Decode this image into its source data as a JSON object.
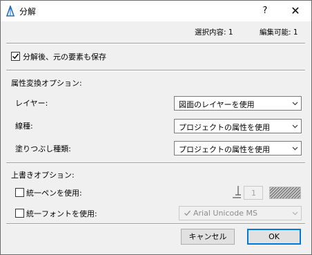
{
  "window": {
    "title": "分解",
    "help": "?",
    "close": "✕"
  },
  "status": {
    "selected": "選択内容: 1",
    "editable": "編集可能: 1"
  },
  "options": {
    "keep_original_label": "分解後、元の要素も保存",
    "keep_original_checked": true
  },
  "attributes": {
    "section_label": "属性変換オプション:",
    "layer_label": "レイヤー:",
    "layer_value": "図面のレイヤーを使用",
    "linetype_label": "線種:",
    "linetype_value": "プロジェクトの属性を使用",
    "fill_label": "塗りつぶし種類:",
    "fill_value": "プロジェクトの属性を使用"
  },
  "override": {
    "section_label": "上書きオプション:",
    "pen_label": "統一ペンを使用:",
    "pen_number": "1",
    "font_label": "統一フォントを使用:",
    "font_value": "Arial Unicode MS"
  },
  "buttons": {
    "cancel": "キャンセル",
    "ok": "OK"
  }
}
